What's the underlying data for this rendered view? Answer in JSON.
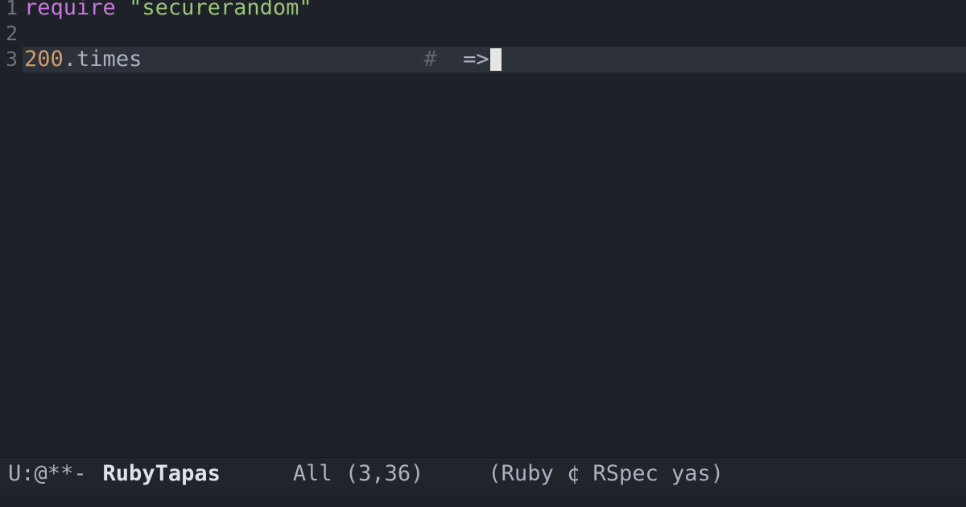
{
  "gutter": {
    "line1": "1",
    "line2": "2",
    "line3": "3"
  },
  "code": {
    "line1": {
      "require": "require",
      "space": " ",
      "quote_open": "\"",
      "string": "securerandom",
      "quote_close": "\""
    },
    "line3": {
      "number": "200",
      "dot": ".",
      "method": "times",
      "comment_hash": "#",
      "arrow": "  =>"
    }
  },
  "modeline": {
    "status": "U:@**-",
    "buffer": "RubyTapas",
    "position": "All (3,36)",
    "modes": "(Ruby ¢ RSpec yas)"
  }
}
